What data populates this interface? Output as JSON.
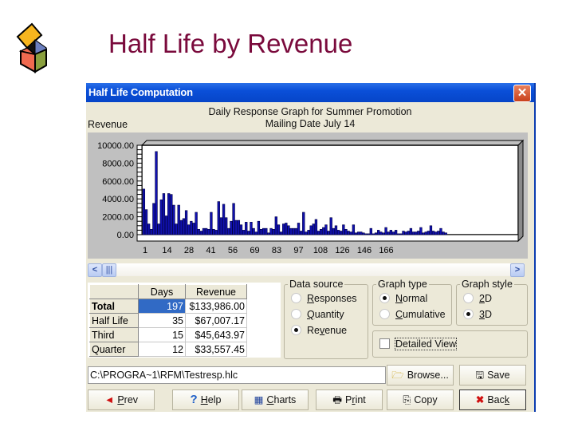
{
  "slide": {
    "title": "Half Life by Revenue",
    "logo_icon": "colored-cube-logo-icon"
  },
  "window": {
    "title": "Half Life Computation",
    "close_icon": "close-icon",
    "graph_title_line1": "Daily Response Graph for Summer Promotion",
    "graph_title_line2": "Mailing Date July 14",
    "y_axis_label": "Revenue"
  },
  "chart_data": {
    "type": "bar",
    "title": "Daily Response Graph for Summer Promotion - Mailing Date July 14",
    "xlabel": "",
    "ylabel": "Revenue",
    "ylim": [
      0,
      10000
    ],
    "style": "3D",
    "bar_color": "#1010b0",
    "y_tick_labels": [
      "10000.00",
      "8000.00",
      "6000.00",
      "4000.00",
      "2000.00",
      "0.00"
    ],
    "x_tick_labels": [
      "1",
      "14",
      "28",
      "41",
      "56",
      "69",
      "83",
      "97",
      "108",
      "126",
      "146",
      "166"
    ],
    "values": [
      5100,
      2800,
      1200,
      600,
      3500,
      9300,
      1200,
      3900,
      4600,
      2100,
      4600,
      4500,
      3300,
      1200,
      3300,
      1600,
      1800,
      2700,
      1100,
      1500,
      1300,
      2500,
      600,
      400,
      700,
      700,
      600,
      2500,
      600,
      500,
      3700,
      1900,
      3400,
      1900,
      700,
      1500,
      3500,
      1600,
      1600,
      1100,
      500,
      1400,
      400,
      1400,
      700,
      300,
      1500,
      600,
      700,
      700,
      200,
      700,
      600,
      2000,
      1100,
      300,
      1200,
      1300,
      1000,
      700,
      700,
      700,
      1300,
      400,
      2500,
      300,
      500,
      1000,
      1200,
      1700,
      400,
      600,
      800,
      1100,
      400,
      1900,
      700,
      1000,
      500,
      400,
      1100,
      600,
      400,
      300,
      1100,
      200,
      300,
      300,
      200,
      100,
      100,
      700,
      100,
      200,
      500,
      300,
      200,
      800,
      300,
      500,
      300,
      500,
      100,
      100,
      400,
      300,
      400,
      700,
      300,
      300,
      400,
      800,
      200,
      300,
      400,
      1000,
      400,
      300,
      400,
      700,
      300,
      200
    ]
  },
  "scrollbar": {
    "left_icon": "scroll-left-icon",
    "right_icon": "scroll-right-icon",
    "thumb_icon": "scroll-thumb-icon"
  },
  "summary_table": {
    "headers": [
      "",
      "Days",
      "Revenue"
    ],
    "rows": [
      {
        "label": "Total",
        "days": "197",
        "revenue": "$133,986.00"
      },
      {
        "label": "Half Life",
        "days": "35",
        "revenue": "$67,007.17"
      },
      {
        "label": "Third",
        "days": "15",
        "revenue": "$45,643.97"
      },
      {
        "label": "Quarter",
        "days": "12",
        "revenue": "$33,557.45"
      }
    ]
  },
  "data_source": {
    "legend": "Data source",
    "options": [
      {
        "pre": "",
        "u": "R",
        "post": "esponses",
        "selected": false
      },
      {
        "pre": "",
        "u": "Q",
        "post": "uantity",
        "selected": false
      },
      {
        "pre": "Re",
        "u": "v",
        "post": "enue",
        "selected": true
      }
    ]
  },
  "graph_type": {
    "legend": "Graph type",
    "options": [
      {
        "pre": "",
        "u": "N",
        "post": "ormal",
        "selected": true
      },
      {
        "pre": "",
        "u": "C",
        "post": "umulative",
        "selected": false
      }
    ]
  },
  "graph_style": {
    "legend": "Graph style",
    "options": [
      {
        "pre": "",
        "u": "2",
        "post": "D",
        "selected": false
      },
      {
        "pre": "",
        "u": "3",
        "post": "D",
        "selected": true
      }
    ]
  },
  "detailed_view": {
    "label": "Detailed View",
    "checked": false
  },
  "file_path": "C:\\PROGRA~1\\RFM\\Testresp.hlc",
  "buttons": {
    "browse": "Browse...",
    "save": "Save",
    "prev_u": "P",
    "prev_rest": "rev",
    "help_u": "H",
    "help_rest": "elp",
    "charts_u": "C",
    "charts_rest": "harts",
    "print_pre": "P",
    "print_u": "r",
    "print_rest": "int",
    "copy": "Copy",
    "back_pre": "Bac",
    "back_u": "k"
  }
}
